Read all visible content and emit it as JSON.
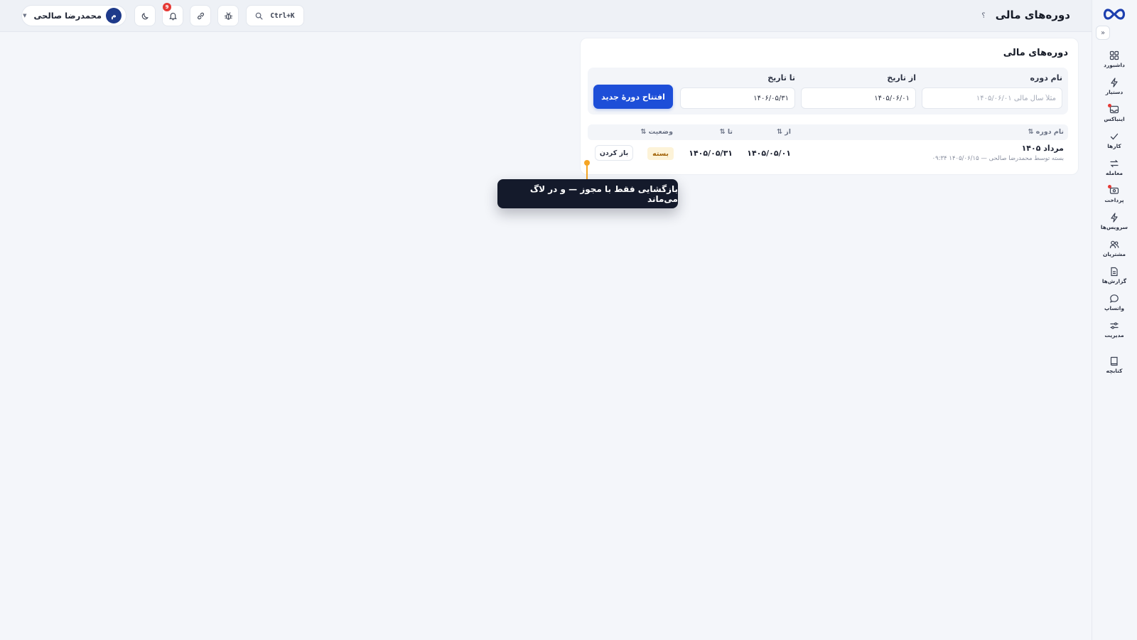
{
  "header": {
    "title": "دوره‌های مالی",
    "help": "؟",
    "search_shortcut": "Ctrl+K",
    "notification_count": "9",
    "user": {
      "name": "محمدرضا صالحی",
      "initial": "م"
    }
  },
  "sidebar": {
    "items": [
      {
        "label": "داشبورد",
        "icon": "dashboard-icon"
      },
      {
        "label": "دستیار",
        "icon": "bolt-icon"
      },
      {
        "label": "اینباکس",
        "icon": "inbox-icon"
      },
      {
        "label": "کارها",
        "icon": "check-icon"
      },
      {
        "label": "معامله",
        "icon": "transfer-icon"
      },
      {
        "label": "پرداخت",
        "icon": "payment-icon"
      },
      {
        "label": "سرویس‌ها",
        "icon": "bolt-icon"
      },
      {
        "label": "مشتریان",
        "icon": "users-icon"
      },
      {
        "label": "گزارش‌ها",
        "icon": "report-icon"
      },
      {
        "label": "واتساپ",
        "icon": "chat-icon"
      },
      {
        "label": "مدیریت",
        "icon": "sliders-icon"
      },
      {
        "label": "کتابچه",
        "icon": "book-icon"
      }
    ]
  },
  "card": {
    "title": "دوره‌های مالی",
    "form": {
      "name_label": "نام دوره",
      "name_placeholder": "مثلاً سال مالی ۱۴۰۵/۰۶/۰۱",
      "from_label": "از تاریخ",
      "from_value": "۱۴۰۵/۰۶/۰۱",
      "to_label": "تا تاریخ",
      "to_value": "۱۴۰۶/۰۵/۳۱",
      "submit_label": "افتتاح دورهٔ جدید"
    },
    "table": {
      "headers": {
        "name": "نام دوره ⇅",
        "from": "از ⇅",
        "to": "تا ⇅",
        "status": "وضعیت ⇅"
      },
      "rows": [
        {
          "name": "مرداد ۱۴۰۵",
          "sub": "بسته توسط محمدرضا صالحی — ۱۴۰۵/۰۶/۱۵ ۰۹:۳۴",
          "from": "۱۴۰۵/۰۵/۰۱",
          "to": "۱۴۰۵/۰۵/۳۱",
          "status": "بسته",
          "action": "باز کردن"
        }
      ]
    }
  },
  "tooltip": {
    "text": "بازگشایی فقط با مجوز — و در لاگ می‌ماند"
  },
  "colors": {
    "primary": "#1d4ed8",
    "status_closed_bg": "#fdf3d8",
    "status_closed_fg": "#a16207",
    "tooltip_bg": "#141a2b",
    "callout": "#f5a524"
  }
}
